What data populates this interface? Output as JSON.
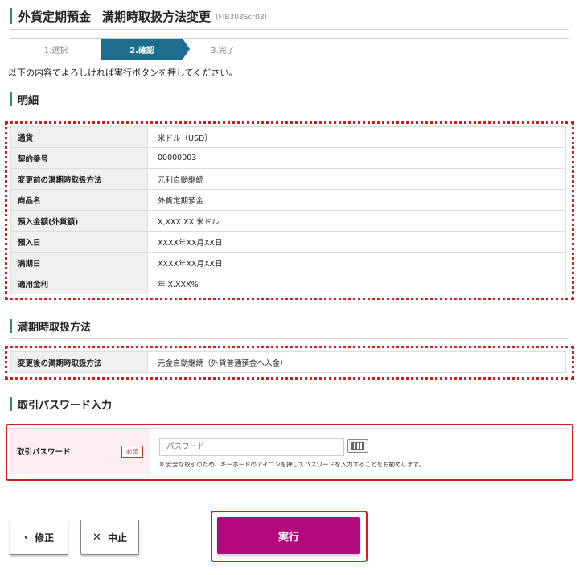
{
  "header": {
    "title": "外貨定期預金",
    "subtitle": "満期時取扱方法変更",
    "screen_code": "(FIB303Scr03)"
  },
  "steps": [
    {
      "label": "1.選択",
      "state": "done"
    },
    {
      "label": "2.確認",
      "state": "current"
    },
    {
      "label": "3.完了",
      "state": "pending"
    }
  ],
  "intro_text": "以下の内容でよろしければ実行ボタンを押してください。",
  "details": {
    "heading": "明細",
    "rows": [
      {
        "label": "通貨",
        "value": "米ドル（USD）"
      },
      {
        "label": "契約番号",
        "value": "00000003"
      },
      {
        "label": "変更前の満期時取扱方法",
        "value": "元利自動継続"
      },
      {
        "label": "商品名",
        "value": "外貨定期預金"
      },
      {
        "label": "預入金額(外貨額)",
        "value": "X,XXX.XX 米ドル"
      },
      {
        "label": "預入日",
        "value": "XXXX年XX月XX日"
      },
      {
        "label": "満期日",
        "value": "XXXX年XX月XX日"
      },
      {
        "label": "適用金利",
        "value": "年 X.XXX%"
      }
    ]
  },
  "maturity": {
    "heading": "満期時取扱方法",
    "rows": [
      {
        "label": "変更後の満期時取扱方法",
        "value": "元金自動継続（外貨普通預金へ入金）"
      }
    ]
  },
  "password": {
    "heading": "取引パスワード入力",
    "label": "取引パスワード",
    "required_badge": "必須",
    "placeholder": "パスワード",
    "value": "",
    "note": "※ 安全な取引のため、キーボードのアイコンを押してパスワードを入力することをお勧めします。"
  },
  "buttons": {
    "back_label": "修正",
    "back_icon": "chevron-left-icon",
    "cancel_label": "中止",
    "cancel_icon": "close-icon",
    "execute_label": "実行"
  },
  "colors": {
    "accent_green": "#2e8b6e",
    "step_active": "#1c6d8f",
    "execute_button": "#b4087e",
    "highlight_red": "#d01e1e"
  }
}
